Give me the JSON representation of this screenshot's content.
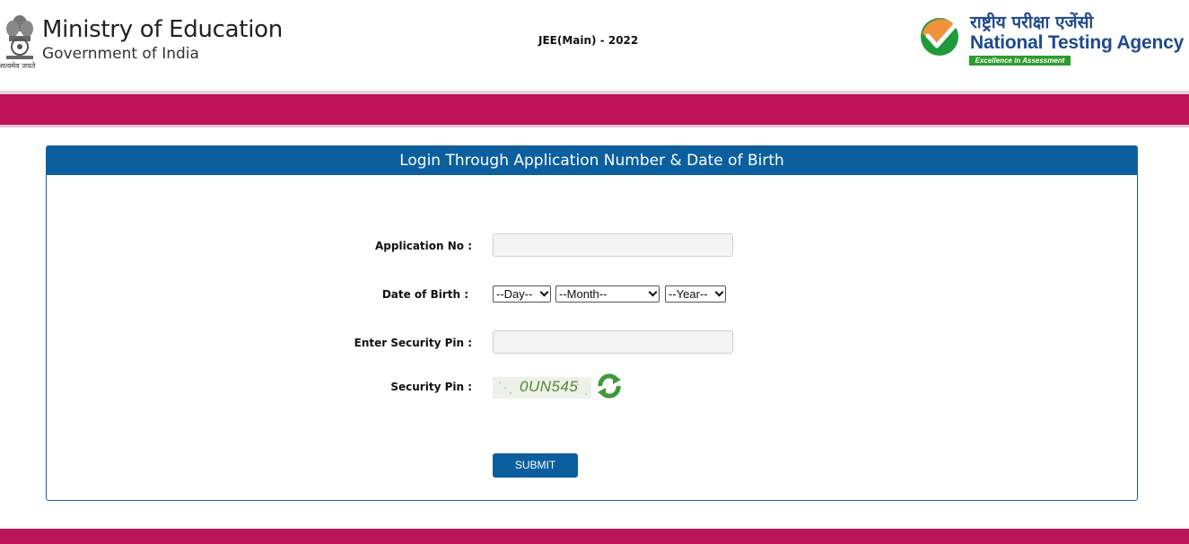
{
  "header": {
    "emblem_motto": "सत्यमेव जयते",
    "ministry_title": "Ministry of Education",
    "ministry_subtitle": "Government of India",
    "exam_title": "JEE(Main) - 2022",
    "agency_hindi": "राष्ट्रीय परीक्षा एजेंसी",
    "agency_name": "National Testing Agency",
    "agency_tagline": "Excellence in Assessment"
  },
  "form": {
    "title": "Login Through Application Number & Date of Birth",
    "application_no_label": "Application No :",
    "application_no_value": "",
    "dob_label": "Date of Birth :",
    "day_selected": "--Day--",
    "month_selected": "--Month--",
    "year_selected": "--Year--",
    "enter_pin_label": "Enter Security Pin :",
    "enter_pin_value": "",
    "security_pin_label": "Security Pin :",
    "captcha_text": "0UN545",
    "submit_label": "SUBMIT"
  },
  "colors": {
    "band": "#bd1358",
    "primary": "#0b5f9f",
    "agency_blue": "#1e4a8c",
    "agency_green": "#2e9b2e"
  },
  "icons": {
    "emblem": "national-emblem-icon",
    "agency_logo": "nta-checkmark-logo-icon",
    "refresh": "refresh-icon"
  }
}
